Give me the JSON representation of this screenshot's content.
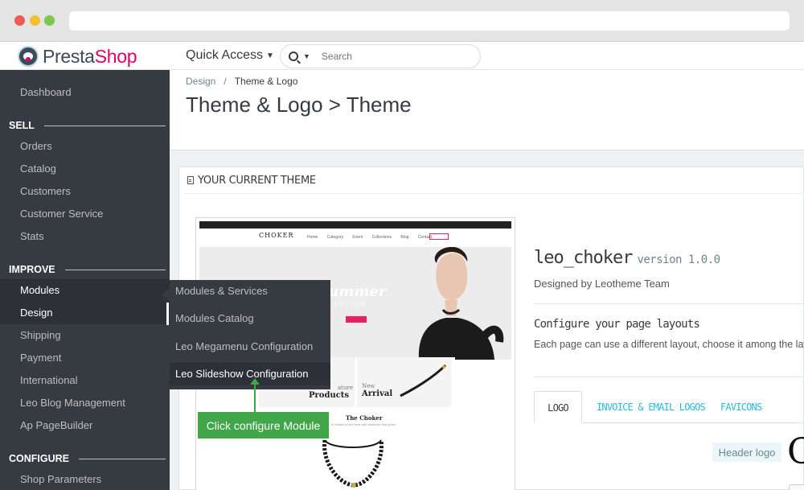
{
  "brand": {
    "logo_part1": "Presta",
    "logo_part2": "Shop",
    "colors": {
      "pink": "#df0067",
      "dark": "#363a41",
      "accent": "#25b9d7",
      "callout": "#41a649"
    }
  },
  "header": {
    "quick_access": "Quick Access",
    "search_placeholder": "Search"
  },
  "sidebar": {
    "dashboard": "Dashboard",
    "sell_title": "SELL",
    "sell_items": [
      "Orders",
      "Catalog",
      "Customers",
      "Customer Service",
      "Stats"
    ],
    "improve_title": "IMPROVE",
    "improve_items": [
      "Modules",
      "Design",
      "Shipping",
      "Payment",
      "International",
      "Leo Blog Management",
      "Ap PageBuilder"
    ],
    "configure_title": "CONFIGURE",
    "configure_items": [
      "Shop Parameters"
    ]
  },
  "flyout": {
    "items": [
      "Modules & Services",
      "Modules Catalog",
      "Leo Megamenu Configuration",
      "Leo Slideshow Configuration"
    ]
  },
  "breadcrumb": {
    "parent": "Design",
    "separator": "/",
    "current": "Theme & Logo"
  },
  "page_title": "Theme & Logo > Theme",
  "card": {
    "title": "YOUR CURRENT THEME"
  },
  "preview": {
    "store_name": "CHOKER",
    "nav_links": "Home Category Event Collections Blog Contact",
    "hero_text": "ng/Summer",
    "hero_sub": "COLLECTION",
    "tile1_l1": "ature",
    "tile1_l2": "Products",
    "tile2_l1": "New",
    "tile2_l2": "Arrival",
    "section_title": "The Choker",
    "section_sub": "is Sealed to the best with aesthetic fine gems"
  },
  "callout": "Click configure Module",
  "theme": {
    "name": "leo_choker",
    "version": "version 1.0.0",
    "author": "Designed by Leotheme Team",
    "layouts_title": "Configure your page layouts",
    "layouts_desc": "Each page can use a different layout, choose it among the layouts"
  },
  "tabs": [
    "LOGO",
    "INVOICE & EMAIL LOGOS",
    "FAVICONS"
  ],
  "logo_section": {
    "badge": "Header logo",
    "logo_glyph": "C"
  }
}
